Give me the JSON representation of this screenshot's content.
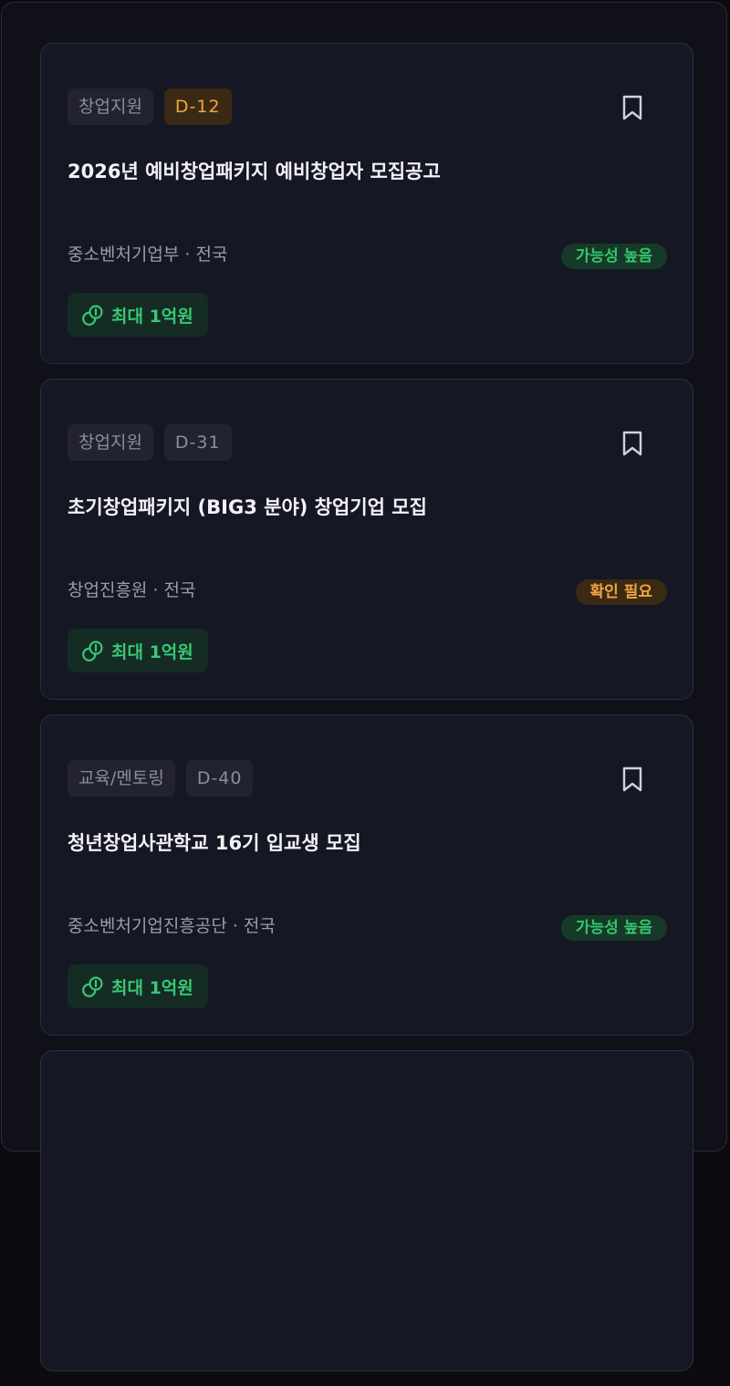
{
  "cards": [
    {
      "category": "창업지원",
      "dday": "D-12",
      "title": "2026년 예비창업패키지 예비창업자 모집공고",
      "org": "중소벤처기업부 · 전국",
      "status": "가능성 높음",
      "amount": "최대 1억원"
    },
    {
      "category": "창업지원",
      "dday": "D-31",
      "title": "초기창업패키지 (BIG3 분야) 창업기업 모집",
      "org": "창업진흥원 · 전국",
      "status": "확인 필요",
      "amount": "최대 1억원"
    },
    {
      "category": "교육/멘토링",
      "dday": "D-40",
      "title": "청년창업사관학교 16기 입교생 모집",
      "org": "중소벤처기업진흥공단 · 전국",
      "status": "가능성 높음",
      "amount": "최대 1억원"
    }
  ],
  "colors": {
    "urgent": "#f3a540",
    "likely": "#36c46f",
    "amount": "#39c777"
  }
}
